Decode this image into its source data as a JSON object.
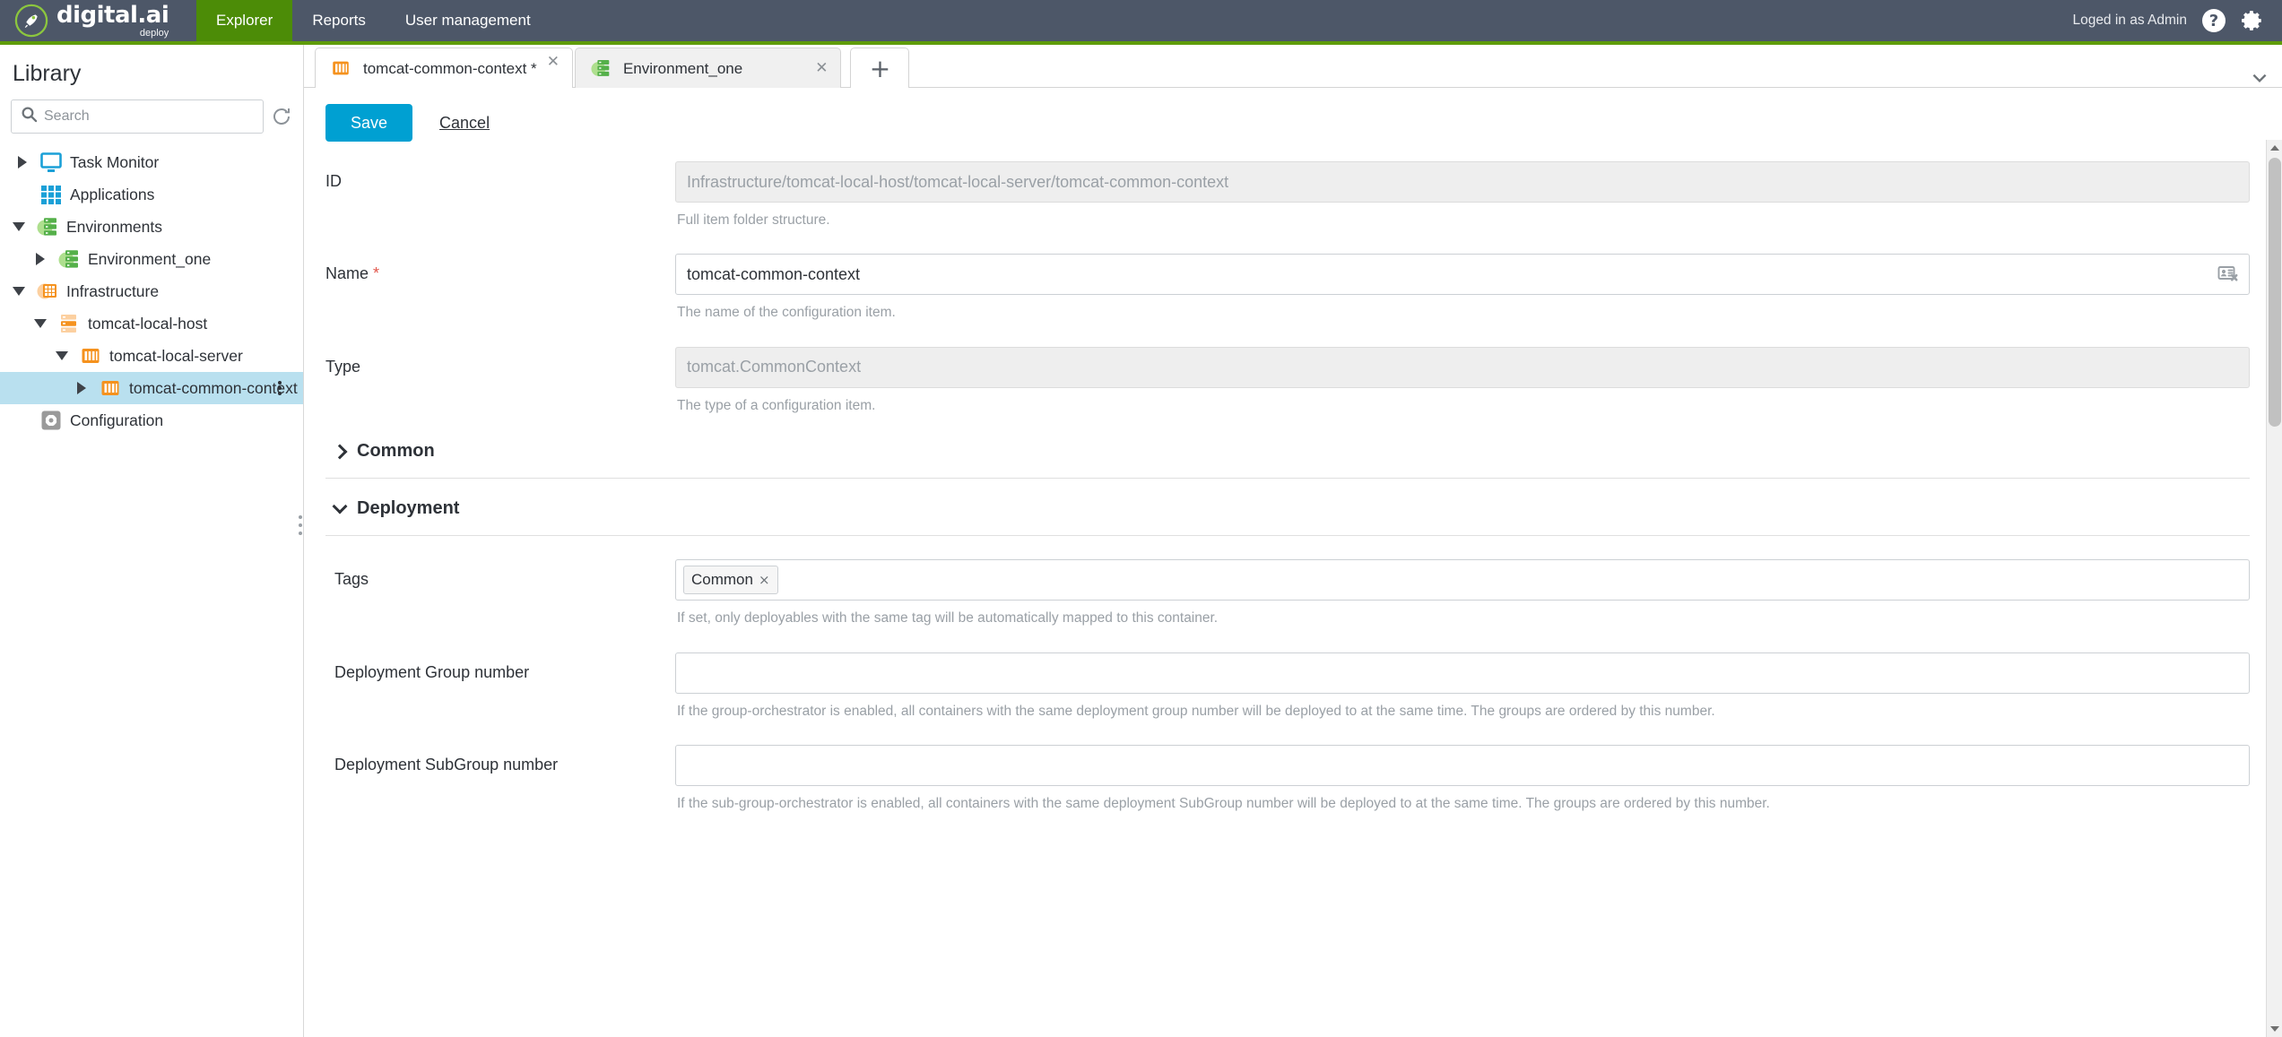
{
  "header": {
    "brand": {
      "name": "digital.ai",
      "sub": "deploy",
      "logo_icon": "rocket-logo-icon"
    },
    "nav": [
      {
        "label": "Explorer",
        "active": true
      },
      {
        "label": "Reports",
        "active": false
      },
      {
        "label": "User management",
        "active": false
      }
    ],
    "logged_in_text": "Loged in as Admin",
    "help_icon": "question-mark-icon",
    "settings_icon": "gear-icon",
    "accent_green": "#5f9c0a",
    "bar_background": "#4d5768"
  },
  "sidebar": {
    "title": "Library",
    "search": {
      "placeholder": "Search",
      "value": "",
      "icon": "search-icon"
    },
    "refresh_icon": "refresh-icon",
    "tree": [
      {
        "label": "Task Monitor",
        "depth": 0,
        "caret": "right",
        "icon": "monitor-icon",
        "selected": false,
        "kebab": false
      },
      {
        "label": "Applications",
        "depth": 0,
        "caret": "none",
        "icon": "grid-apps-icon",
        "selected": false,
        "kebab": false
      },
      {
        "label": "Environments",
        "depth": 0,
        "caret": "down",
        "icon": "environments-icon",
        "selected": false,
        "kebab": false
      },
      {
        "label": "Environment_one",
        "depth": 1,
        "caret": "right",
        "icon": "environments-icon",
        "selected": false,
        "kebab": false
      },
      {
        "label": "Infrastructure",
        "depth": 0,
        "caret": "down",
        "icon": "infrastructure-icon",
        "selected": false,
        "kebab": false
      },
      {
        "label": "tomcat-local-host",
        "depth": 1,
        "caret": "down",
        "icon": "host-icon",
        "selected": false,
        "kebab": false
      },
      {
        "label": "tomcat-local-server",
        "depth": 2,
        "caret": "down",
        "icon": "tomcat-icon",
        "selected": false,
        "kebab": false
      },
      {
        "label": "tomcat-common-context",
        "depth": 3,
        "caret": "right",
        "icon": "tomcat-icon",
        "selected": true,
        "kebab": true
      },
      {
        "label": "Configuration",
        "depth": 0,
        "caret": "none",
        "icon": "configuration-gear-icon",
        "selected": false,
        "kebab": false
      }
    ]
  },
  "tabs": {
    "items": [
      {
        "label": "tomcat-common-context *",
        "icon": "tomcat-icon",
        "active": true,
        "close_glyph": "✕"
      },
      {
        "label": "Environment_one",
        "icon": "environments-icon",
        "active": false,
        "close_glyph": "✕"
      }
    ],
    "add_label": "+",
    "overflow_icon": "chevron-down-icon"
  },
  "form": {
    "save_label": "Save",
    "cancel_label": "Cancel",
    "fields": [
      {
        "label": "ID",
        "required": false,
        "value": "Infrastructure/tomcat-local-host/tomcat-local-server/tomcat-common-context",
        "readonly": true,
        "hint": "Full item folder structure."
      },
      {
        "label": "Name",
        "required": true,
        "value": "tomcat-common-context",
        "readonly": false,
        "hint": "The name of the configuration item.",
        "trailing_icon": "contact-card-remove-icon"
      },
      {
        "label": "Type",
        "required": false,
        "value": "tomcat.CommonContext",
        "readonly": true,
        "hint": "The type of a configuration item."
      }
    ],
    "sections": [
      {
        "title": "Common",
        "expanded": false
      },
      {
        "title": "Deployment",
        "expanded": true
      }
    ],
    "deployment_fields": [
      {
        "label": "Tags",
        "type": "chips",
        "chips": [
          {
            "label": "Common",
            "remove_glyph": "×"
          }
        ],
        "hint": "If set, only deployables with the same tag will be automatically mapped to this container."
      },
      {
        "label": "Deployment Group number",
        "type": "text",
        "value": "",
        "hint": "If the group-orchestrator is enabled, all containers with the same deployment group number will be deployed to at the same time. The groups are ordered by this number."
      },
      {
        "label": "Deployment SubGroup number",
        "type": "text",
        "value": "",
        "hint": "If the sub-group-orchestrator is enabled, all containers with the same deployment SubGroup number will be deployed to at the same time. The groups are ordered by this number."
      }
    ]
  },
  "scrollbar": {
    "up_icon": "triangle-up-icon",
    "down_icon": "triangle-down-icon"
  }
}
